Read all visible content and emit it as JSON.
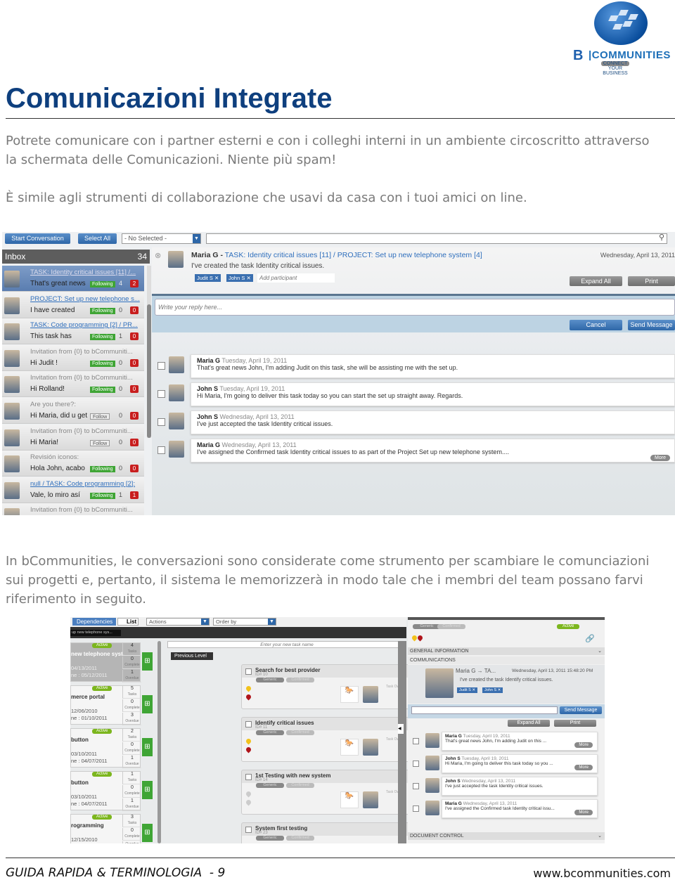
{
  "logo": {
    "brand": "B|COMMUNITIES",
    "tagline": "CONNECT YOUR BUSINESS",
    "color": "#1d6fb8"
  },
  "title": "Comunicazioni Integrate",
  "paragraphs": [
    "Potrete comunicare con i partner esterni e con i colleghi interni in un ambiente circoscritto attraverso la schermata delle Comunicazioni. Niente più spam!",
    "È simile agli strumenti di collaborazione che usavi da casa con i tuoi amici on line.",
    "In bCommunities, le conversazioni sono considerate come strumento per scambiare le comunciazioni sui progetti e, pertanto, il sistema le memorizzerà in modo tale che i membri del team possano farvi riferimento in seguito."
  ],
  "shot1": {
    "toolbar": {
      "start": "Start Conversation",
      "select_all": "Select All",
      "filter": "- No Selected -"
    },
    "inbox": {
      "label": "Inbox",
      "count": "34"
    },
    "items": [
      {
        "subject": "TASK: Identity critical issues [11] /...",
        "preview": "That's great news",
        "follow": "Following",
        "count": "4",
        "badge": "2",
        "link": true,
        "active": true
      },
      {
        "subject": "PROJECT: Set up new telephone s...",
        "preview": "I have created",
        "follow": "Following",
        "count": "0",
        "badge": "0",
        "link": true
      },
      {
        "subject": "TASK: Code programming [2] / PR...",
        "preview": "This task has",
        "follow": "Following",
        "count": "1",
        "badge": "0",
        "link": true
      },
      {
        "subject": "Invitation from {0} to bCommuniti...",
        "preview": "Hi Judit !",
        "follow": "Following",
        "count": "0",
        "badge": "0"
      },
      {
        "subject": "Invitation from {0} to bCommuniti...",
        "preview": "Hi Rolland!",
        "follow": "Following",
        "count": "0",
        "badge": "0"
      },
      {
        "subject": "Are you there?:",
        "preview": "Hi Maria, did u get",
        "follow": "Follow",
        "count": "0",
        "badge": "0"
      },
      {
        "subject": "Invitation from {0} to bCommuniti...",
        "preview": "Hi Maria!",
        "follow": "Follow",
        "count": "0",
        "badge": "0"
      },
      {
        "subject": "Revisión iconos:",
        "preview": "Hola John, acabo",
        "follow": "Following",
        "count": "0",
        "badge": "0"
      },
      {
        "subject": "null / TASK: Code programming [2]:",
        "preview": "Vale, lo miro así",
        "follow": "Following",
        "count": "1",
        "badge": "1",
        "link": true
      },
      {
        "subject": "Invitation from {0} to bCommuniti...",
        "preview": "",
        "follow": "",
        "count": "",
        "badge": ""
      }
    ],
    "thread": {
      "author": "Maria G",
      "sep": "-",
      "subject": "TASK: Identity critical issues [11] / PROJECT: Set up new telephone system [4]",
      "date": "Wednesday, April 13, 2011",
      "text": "I've created the task Identity critical issues.",
      "participants": [
        "Judit S",
        "John S"
      ],
      "add_placeholder": "Add participant",
      "expand": "Expand All",
      "print": "Print",
      "reply_placeholder": "Write your reply here...",
      "cancel": "Cancel",
      "send": "Send Message",
      "more": "More"
    },
    "messages": [
      {
        "author": "Maria G",
        "date": "Tuesday, April 19, 2011",
        "text": "That's great news John, I'm adding Judit on this task, she will be assisting me with the set up."
      },
      {
        "author": "John S",
        "date": "Tuesday, April 19, 2011",
        "text": "Hi Maria, I'm going to deliver this task today so you can start the set up straight away. Regards."
      },
      {
        "author": "John S",
        "date": "Wednesday, April 13, 2011",
        "text": "I've just accepted the task Identity critical issues."
      },
      {
        "author": "Maria G",
        "date": "Wednesday, April 13, 2011",
        "text": "I've assigned the Confirmed task Identity critical issues to as part of the Project Set up new telephone system...."
      }
    ]
  },
  "shot2": {
    "toolbar": {
      "dependencies": "Dependencies",
      "list": "List",
      "actions": "Actions",
      "order": "Order by"
    },
    "breadcrumb": "up new telephone sys...",
    "active": "Active",
    "stat_labels": [
      "Tasks",
      "Complete",
      "Overdue"
    ],
    "projects": [
      {
        "name": "new telephone syst.",
        "start": "04/13/2011",
        "end": "ne : 05/12/2011",
        "stats": [
          "4",
          "0",
          "1"
        ]
      },
      {
        "name": "merce portal",
        "start": "12/06/2010",
        "end": "ne : 01/10/2011",
        "stats": [
          "5",
          "0",
          "3"
        ]
      },
      {
        "name": "button",
        "start": "03/10/2011",
        "end": "ne : 04/07/2011",
        "stats": [
          "2",
          "0",
          "1"
        ]
      },
      {
        "name": "button",
        "start": "03/10/2011",
        "end": "ne : 04/07/2011",
        "stats": [
          "1",
          "0",
          "1"
        ]
      },
      {
        "name": "rogramming",
        "start": "12/15/2010",
        "end": "",
        "stats": [
          "3",
          "0",
          ""
        ]
      }
    ],
    "new_task_placeholder": "Enter your new task name",
    "previous_level": "Previous Level",
    "tag_generic": "Generic",
    "tag_confirmed": "Confirmed",
    "task_owner": "Task Owner",
    "tasks": [
      {
        "name": "Search for best provider",
        "id": "ID# 10",
        "start": "Start : 04/13/2011",
        "deadline": "Deadline : 05/12/2011"
      },
      {
        "name": "Identify critical issues",
        "id": "ID# 11",
        "start": "Start : 04/13/2011",
        "deadline": "Deadline : 05/12/2011"
      },
      {
        "name": "1st Testing with new system",
        "id": "ID# 14",
        "start": "Start : 04/20/2011",
        "deadline": "Deadline : 04/20/2011"
      },
      {
        "name": "System first testing",
        "id": "ID# 23"
      }
    ],
    "detail": {
      "general": "GENERAL INFORMATION",
      "communications": "COMMUNICATIONS",
      "document": "DOCUMENT CONTROL",
      "author": "Maria G → TA...",
      "date": "Wednesday, April 13, 2011 15:48:20 PM",
      "text": "I've created the task Identify critical issues.",
      "participants": [
        "Judit S",
        "John S"
      ],
      "send": "Send Message",
      "expand": "Expand All",
      "print": "Print",
      "more": "More",
      "messages": [
        {
          "author": "Maria G",
          "date": "Tuesday, April 19, 2011",
          "text": "That's great news John, I'm adding Judit on this ...",
          "more": true
        },
        {
          "author": "John S",
          "date": "Tuesday, April 19, 2011",
          "text": "Hi Maria, I'm going to deliver this task today so you ...",
          "more": true
        },
        {
          "author": "John S",
          "date": "Wednesday, April 13, 2011",
          "text": "I've just accepted the task Identity critical issues."
        },
        {
          "author": "Maria G",
          "date": "Wednesday, April 13, 2011",
          "text": "I've assigned the Confirmed task Identity critical issu...",
          "more": true
        }
      ]
    }
  },
  "footer": {
    "left": "GUIDA RAPIDA & TERMINOLOGIA  - 9",
    "right": "www.bcommunities.com"
  }
}
